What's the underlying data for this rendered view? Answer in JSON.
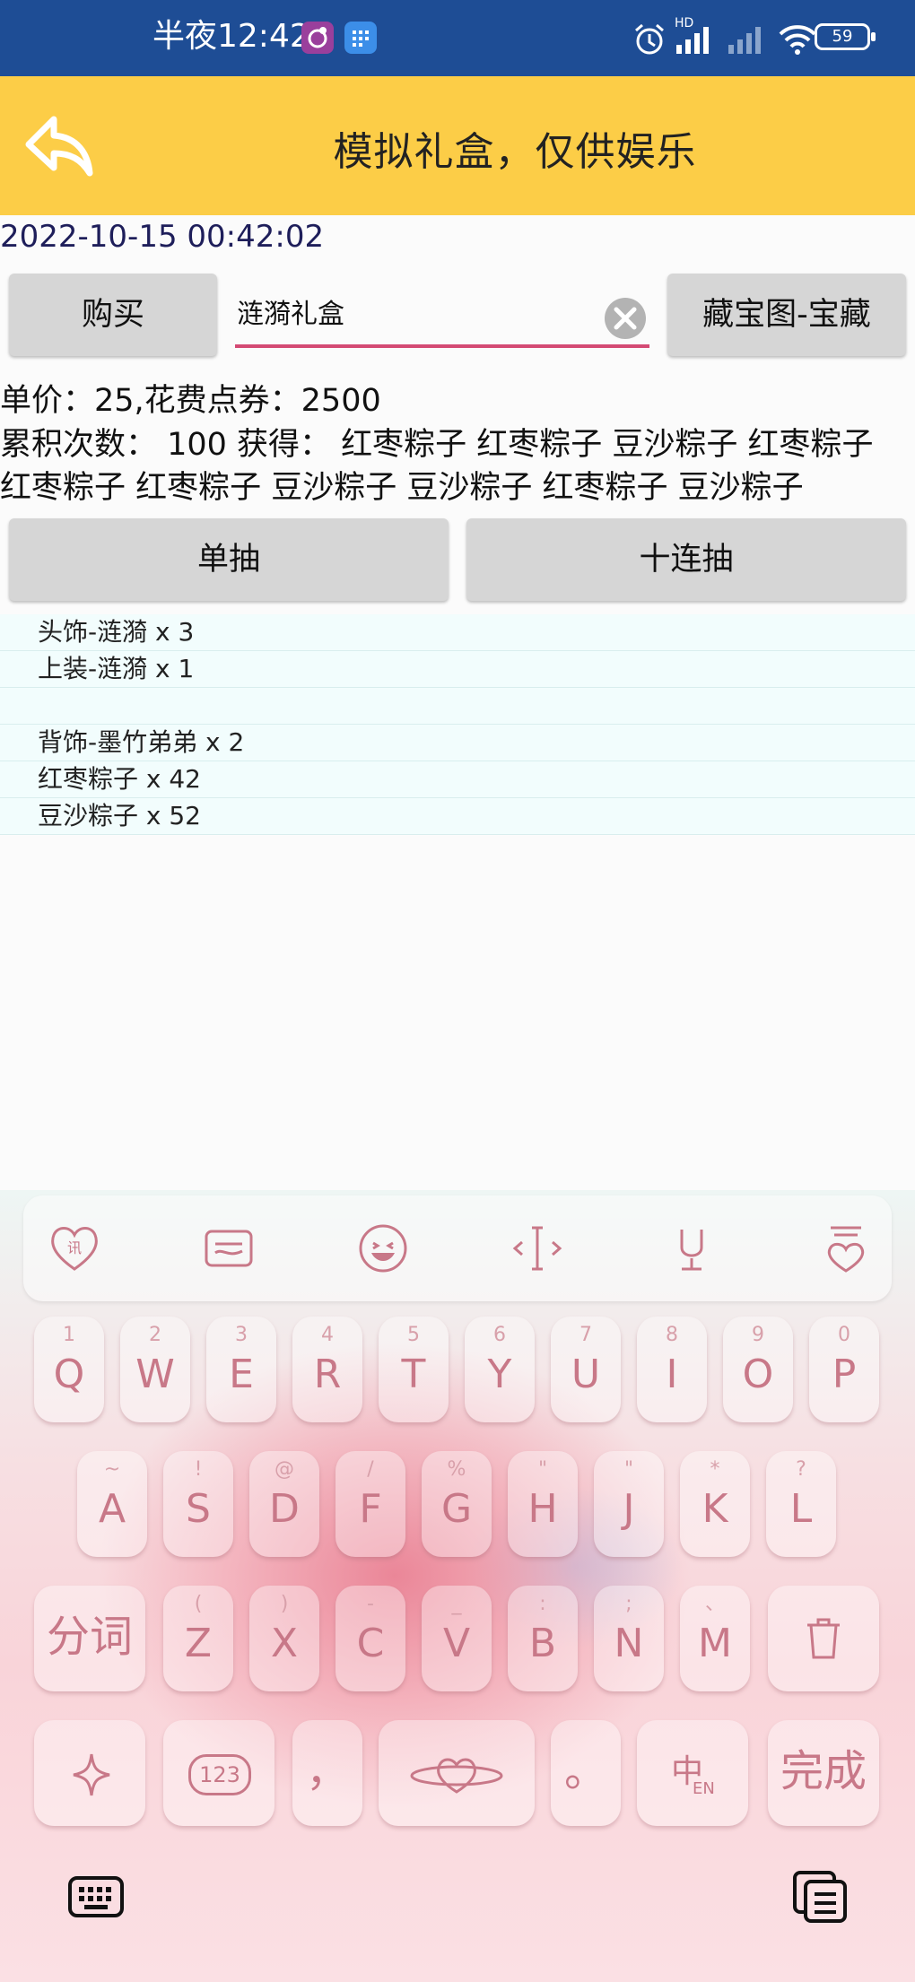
{
  "status_bar": {
    "time": "半夜12:42",
    "battery": "59",
    "network_label": "HD"
  },
  "header": {
    "title": "模拟礼盒，仅供娱乐"
  },
  "datetime": "2022-10-15 00:42:02",
  "actions": {
    "buy_label": "购买",
    "search_value": "涟漪礼盒",
    "treasure_label": "藏宝图-宝藏",
    "single_draw_label": "单抽",
    "ten_draw_label": "十连抽"
  },
  "info": {
    "price_line": "单价：25,花费点券：2500",
    "gain_line_1": "累积次数： 100 获得：  红枣粽子 红枣粽子 豆沙粽子 红枣粽子",
    "gain_line_2": "红枣粽子 红枣粽子 豆沙粽子 豆沙粽子 红枣粽子 豆沙粽子"
  },
  "results": [
    "头饰-涟漪 x 3",
    "上装-涟漪 x 1",
    "",
    "背饰-墨竹弟弟 x 2",
    "红枣粽子 x 42",
    "豆沙粽子 x 52"
  ],
  "keyboard": {
    "toolbar_icons": [
      "heart-logo-icon",
      "clipboard-icon",
      "emoji-icon",
      "cursor-move-icon",
      "microphone-icon",
      "theme-icon"
    ],
    "row1": [
      {
        "key": "Q",
        "sub": "1"
      },
      {
        "key": "W",
        "sub": "2"
      },
      {
        "key": "E",
        "sub": "3"
      },
      {
        "key": "R",
        "sub": "4"
      },
      {
        "key": "T",
        "sub": "5"
      },
      {
        "key": "Y",
        "sub": "6"
      },
      {
        "key": "U",
        "sub": "7"
      },
      {
        "key": "I",
        "sub": "8"
      },
      {
        "key": "O",
        "sub": "9"
      },
      {
        "key": "P",
        "sub": "0"
      }
    ],
    "row2": [
      {
        "key": "A",
        "sub": "~"
      },
      {
        "key": "S",
        "sub": "!"
      },
      {
        "key": "D",
        "sub": "@"
      },
      {
        "key": "F",
        "sub": "/"
      },
      {
        "key": "G",
        "sub": "%"
      },
      {
        "key": "H",
        "sub": "\""
      },
      {
        "key": "J",
        "sub": "\""
      },
      {
        "key": "K",
        "sub": "*"
      },
      {
        "key": "L",
        "sub": "?"
      }
    ],
    "row3": [
      {
        "key": "Z",
        "sub": "("
      },
      {
        "key": "X",
        "sub": ")"
      },
      {
        "key": "C",
        "sub": "-"
      },
      {
        "key": "V",
        "sub": "_"
      },
      {
        "key": "B",
        "sub": ":"
      },
      {
        "key": "N",
        "sub": ";"
      },
      {
        "key": "M",
        "sub": "、"
      }
    ],
    "segment_label": "分词",
    "comma_label": "，",
    "period_label": "。",
    "done_label": "完成",
    "num_label": "123",
    "lang_label": "EN"
  },
  "colors": {
    "status_bar": "#1e4d95",
    "title_bar": "#fccd47",
    "button": "#d6d6d6",
    "input_underline": "#d44a74",
    "list_row": "#f2fdfd"
  }
}
